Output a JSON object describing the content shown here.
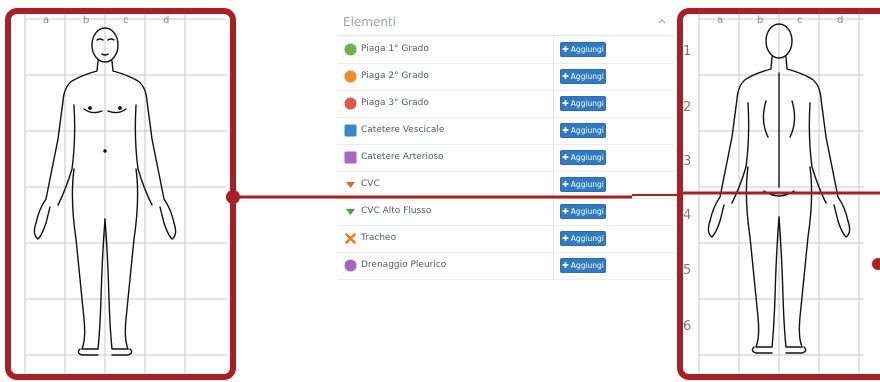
{
  "left_chart": {
    "columns": [
      "a",
      "b",
      "c",
      "d"
    ]
  },
  "right_chart": {
    "columns": [
      "a",
      "b",
      "c",
      "d"
    ],
    "rows": [
      "1",
      "2",
      "3",
      "4",
      "5",
      "6"
    ]
  },
  "panel": {
    "title": "Elementi",
    "add_label": "Aggiungi",
    "items": [
      {
        "label": "Piaga 1° Grado",
        "icon": "circle-icon",
        "color": "#6bb34a"
      },
      {
        "label": "Piaga 2° Grado",
        "icon": "circle-icon",
        "color": "#f58a2a"
      },
      {
        "label": "Piaga 3° Grado",
        "icon": "circle-icon",
        "color": "#e2564a"
      },
      {
        "label": "Catetere Vescicale",
        "icon": "square-icon",
        "color": "#3d86c6"
      },
      {
        "label": "Catetere Arterioso",
        "icon": "square-icon",
        "color": "#a866c0"
      },
      {
        "label": "CVC",
        "icon": "triangle-down-icon",
        "color": "#e0622a"
      },
      {
        "label": "CVC Alto Flusso",
        "icon": "triangle-down-icon",
        "color": "#4aa34a"
      },
      {
        "label": "Tracheo",
        "icon": "cross-icon",
        "color": "#f07a1e"
      },
      {
        "label": "Drenaggio Pleurico",
        "icon": "circle-icon",
        "color": "#a466c4"
      }
    ]
  },
  "colors": {
    "frame": "#aa1f24",
    "button": "#2f7bc3"
  }
}
